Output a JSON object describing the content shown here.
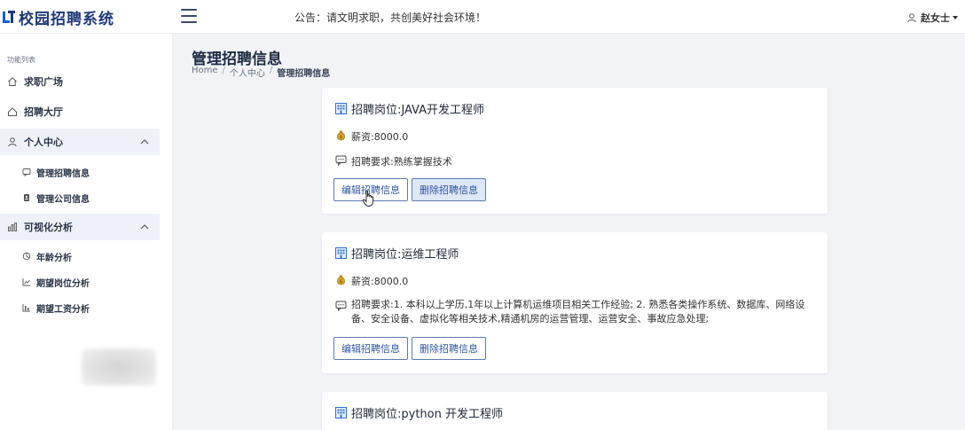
{
  "app": {
    "title": "校园招聘系统"
  },
  "header": {
    "notice": "公告：请文明求职，共创美好社会环境！",
    "user_name": "赵女士"
  },
  "sidebar": {
    "caption": "功能列表",
    "items": [
      {
        "label": "求职广场",
        "icon": "home-icon"
      },
      {
        "label": "招聘大厅",
        "icon": "house-icon"
      },
      {
        "label": "个人中心",
        "icon": "user-icon",
        "expanded": true,
        "children": [
          {
            "label": "管理招聘信息",
            "icon": "message-icon"
          },
          {
            "label": "管理公司信息",
            "icon": "id-card-icon"
          }
        ]
      },
      {
        "label": "可视化分析",
        "icon": "bar-chart-icon",
        "expanded": true,
        "children": [
          {
            "label": "年龄分析",
            "icon": "pie-chart-icon"
          },
          {
            "label": "期望岗位分析",
            "icon": "line-chart-icon"
          },
          {
            "label": "期望工资分析",
            "icon": "bar-chart-small-icon"
          }
        ]
      }
    ]
  },
  "main": {
    "page_title": "管理招聘信息",
    "breadcrumb": [
      "Home",
      "个人中心",
      "管理招聘信息"
    ],
    "cards": [
      {
        "title": "招聘岗位:JAVA开发工程师",
        "salary": "薪资:8000.0",
        "requirement": "招聘要求:熟练掌握技术",
        "edit_label": "编辑招聘信息",
        "delete_label": "删除招聘信息"
      },
      {
        "title": "招聘岗位:运维工程师",
        "salary": "薪资:8000.0",
        "requirement": "招聘要求:1. 本科以上学历,1年以上计算机运维项目相关工作经验; 2. 熟悉各类操作系统、数据库、网络设备、安全设备、虚拟化等相关技术,精通机房的运营管理、运营安全、事故应急处理;",
        "edit_label": "编辑招聘信息",
        "delete_label": "删除招聘信息"
      },
      {
        "title": "招聘岗位:python 开发工程师"
      }
    ]
  },
  "colors": {
    "brand": "#1e3a7b",
    "button_border": "#5b7bb4",
    "button_text": "#2f55a4",
    "sidebar_group_bg": "#eef2f8"
  }
}
